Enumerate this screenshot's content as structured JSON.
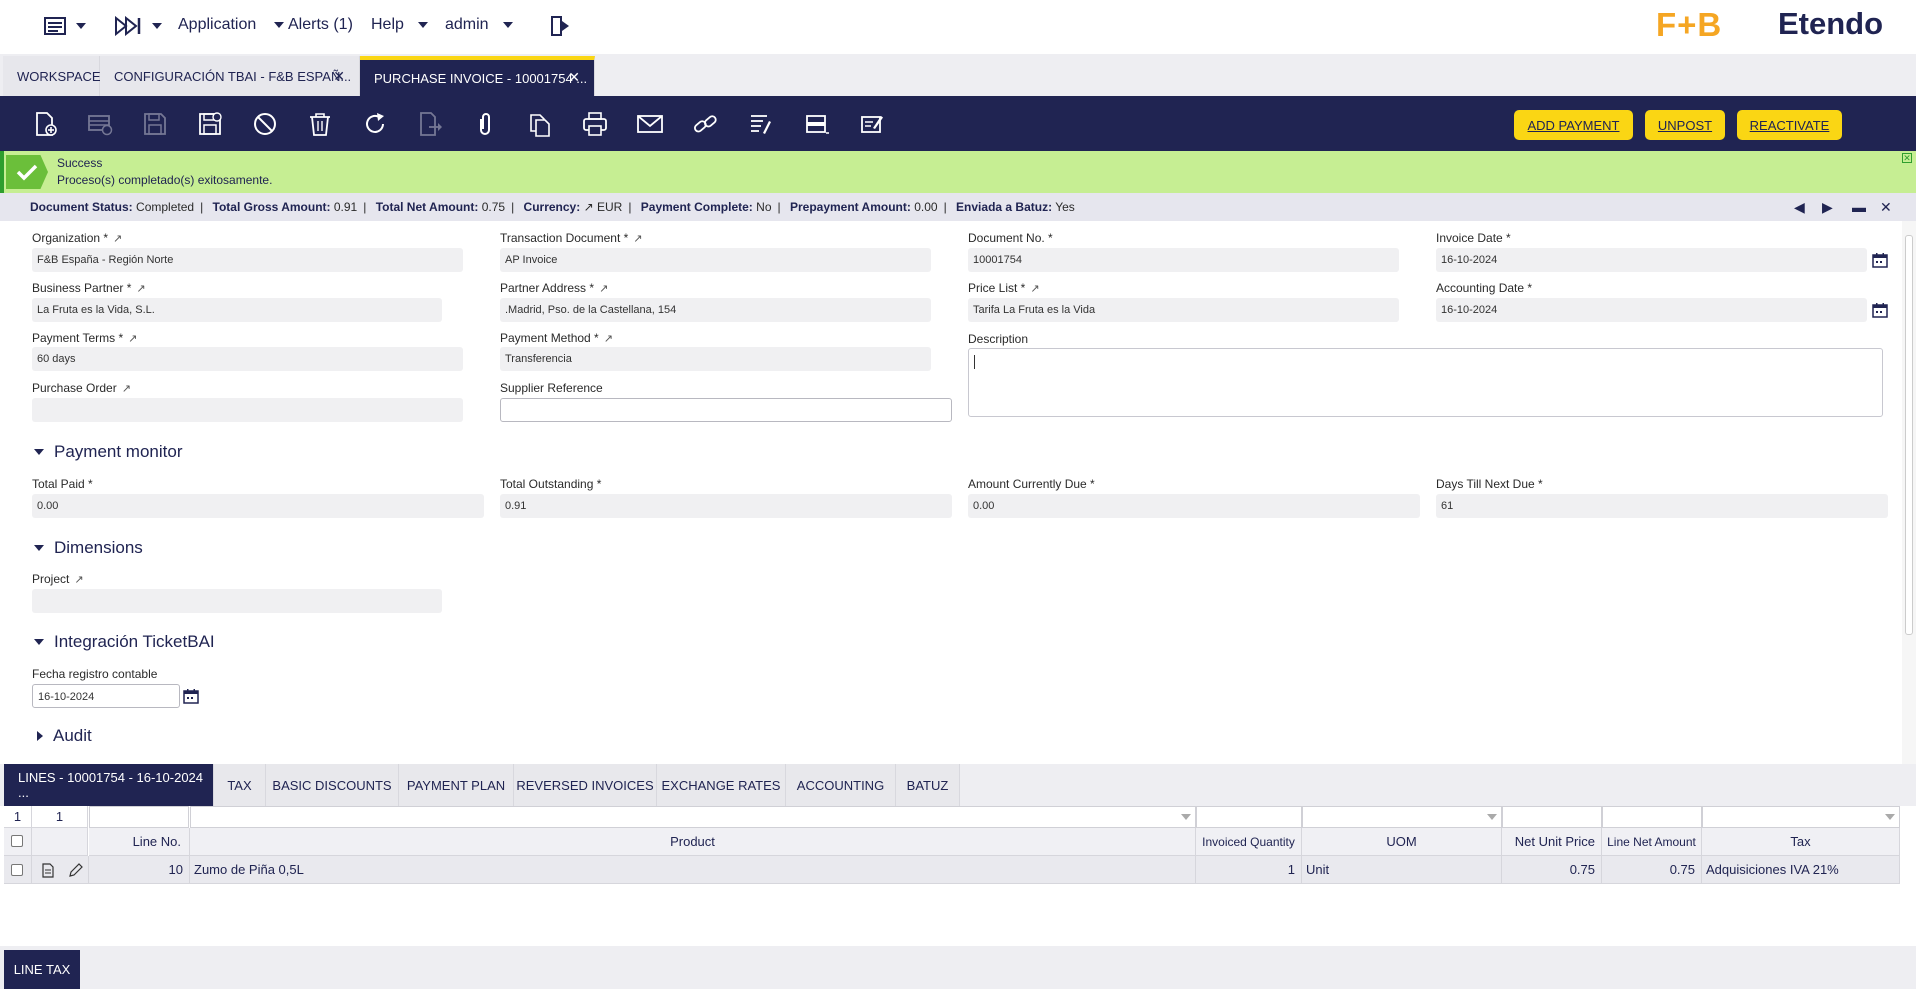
{
  "nav": {
    "application": "Application",
    "alerts": "Alerts (1)",
    "help": "Help",
    "user": "admin"
  },
  "brand": {
    "client_logo": "F+B",
    "product_logo": "Etendo"
  },
  "tabs": [
    {
      "label": "WORKSPACE"
    },
    {
      "label": "CONFIGURACIÓN TBAI - F&B ESPAÑ..."
    },
    {
      "label": "PURCHASE INVOICE - 10001754 ..."
    }
  ],
  "toolbar": {
    "add_payment": "ADD PAYMENT",
    "unpost": "UNPOST",
    "reactivate": "REACTIVATE"
  },
  "banner": {
    "title": "Success",
    "message": "Proceso(s) completado(s) exitosamente."
  },
  "status": {
    "document_status_label": "Document Status:",
    "document_status": "Completed",
    "total_gross_label": "Total Gross Amount:",
    "total_gross": "0.91",
    "total_net_label": "Total Net Amount:",
    "total_net": "0.75",
    "currency_label": "Currency:",
    "currency": "EUR",
    "payment_complete_label": "Payment Complete:",
    "payment_complete": "No",
    "prepayment_label": "Prepayment Amount:",
    "prepayment": "0.00",
    "batuz_label": "Enviada a Batuz:",
    "batuz": "Yes"
  },
  "form": {
    "organization": {
      "label": "Organization *",
      "value": "F&B España - Región Norte"
    },
    "transaction_document": {
      "label": "Transaction Document *",
      "value": "AP Invoice"
    },
    "document_no": {
      "label": "Document No. *",
      "value": "10001754"
    },
    "invoice_date": {
      "label": "Invoice Date *",
      "value": "16-10-2024"
    },
    "business_partner": {
      "label": "Business Partner *",
      "value": "La Fruta es la Vida, S.L."
    },
    "partner_address": {
      "label": "Partner Address *",
      "value": ".Madrid, Pso. de la Castellana, 154"
    },
    "price_list": {
      "label": "Price List *",
      "value": "Tarifa La Fruta es la Vida"
    },
    "accounting_date": {
      "label": "Accounting Date *",
      "value": "16-10-2024"
    },
    "payment_terms": {
      "label": "Payment Terms *",
      "value": "60 days"
    },
    "payment_method": {
      "label": "Payment Method *",
      "value": "Transferencia"
    },
    "description": {
      "label": "Description",
      "value": ""
    },
    "purchase_order": {
      "label": "Purchase Order",
      "value": ""
    },
    "supplier_reference": {
      "label": "Supplier Reference",
      "value": ""
    }
  },
  "payment_monitor": {
    "title": "Payment monitor",
    "total_paid": {
      "label": "Total Paid *",
      "value": "0.00"
    },
    "total_outstanding": {
      "label": "Total Outstanding *",
      "value": "0.91"
    },
    "amount_due": {
      "label": "Amount Currently Due *",
      "value": "0.00"
    },
    "days_till_due": {
      "label": "Days Till Next Due *",
      "value": "61"
    }
  },
  "dimensions": {
    "title": "Dimensions",
    "project": {
      "label": "Project",
      "value": ""
    }
  },
  "tbai": {
    "title": "Integración TicketBAI",
    "fecha": {
      "label": "Fecha registro contable",
      "value": "16-10-2024"
    }
  },
  "audit": {
    "title": "Audit"
  },
  "lower_tabs": [
    {
      "label": "LINES - 10001754 - 16-10-2024 ..."
    },
    {
      "label": "TAX"
    },
    {
      "label": "BASIC DISCOUNTS"
    },
    {
      "label": "PAYMENT PLAN"
    },
    {
      "label": "REVERSED INVOICES"
    },
    {
      "label": "EXCHANGE RATES"
    },
    {
      "label": "ACCOUNTING"
    },
    {
      "label": "BATUZ"
    }
  ],
  "grid": {
    "counter_a": "1",
    "counter_b": "1",
    "columns": {
      "line_no": "Line No.",
      "product": "Product",
      "invoiced_qty": "Invoiced Quantity",
      "uom": "UOM",
      "net_unit_price": "Net Unit Price",
      "line_net_amount": "Line Net Amount",
      "tax": "Tax"
    },
    "rows": [
      {
        "line_no": "10",
        "product": "Zumo de Piña 0,5L",
        "invoiced_qty": "1",
        "uom": "Unit",
        "net_unit_price": "0.75",
        "line_net_amount": "0.75",
        "tax": "Adquisiciones IVA 21%"
      }
    ]
  },
  "bottom_tab": {
    "label": "LINE TAX"
  },
  "colors": {
    "navy": "#202452",
    "yellow": "#fad614",
    "success_bg": "#c6ee93",
    "success_icon": "#6bbf3a"
  }
}
